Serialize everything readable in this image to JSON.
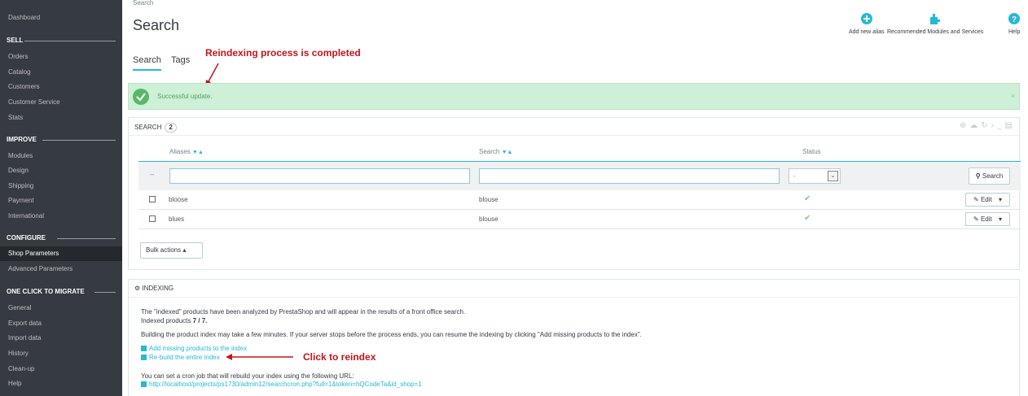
{
  "sidebar": {
    "dashboard": "Dashboard",
    "sections": [
      {
        "title": "SELL",
        "items": [
          "Orders",
          "Catalog",
          "Customers",
          "Customer Service",
          "Stats"
        ]
      },
      {
        "title": "IMPROVE",
        "items": [
          "Modules",
          "Design",
          "Shipping",
          "Payment",
          "International"
        ]
      },
      {
        "title": "CONFIGURE",
        "items": [
          "Shop Parameters",
          "Advanced Parameters"
        ]
      },
      {
        "title": "ONE CLICK TO MIGRATE",
        "items": [
          "General",
          "Export data",
          "Import data",
          "History",
          "Clean-up",
          "Help"
        ]
      }
    ],
    "active_item": "Shop Parameters"
  },
  "header": {
    "breadcrumb": "Search",
    "title": "Search",
    "toolbar": [
      {
        "label": "Add new alias",
        "icon": "plus-circle-icon"
      },
      {
        "label": "Recommended Modules and Services",
        "icon": "puzzle-icon"
      },
      {
        "label": "Help",
        "icon": "question-icon"
      }
    ]
  },
  "tabs": [
    "Search",
    "Tags"
  ],
  "annotations": {
    "reindex_done": "Reindexing process is completed",
    "click_reindex": "Click to reindex"
  },
  "alert": {
    "message": "Successful update.",
    "close": "×"
  },
  "search_panel": {
    "title": "SEARCH",
    "count": "2",
    "columns": [
      "Aliases",
      "Search",
      "Status"
    ],
    "filter_reset": "--",
    "status_select": "-",
    "search_button": "Search",
    "rows": [
      {
        "alias": "bloose",
        "search": "blouse",
        "status": "✔",
        "action": "Edit"
      },
      {
        "alias": "blues",
        "search": "blouse",
        "status": "✔",
        "action": "Edit"
      }
    ],
    "bulk_actions": "Bulk actions ▴",
    "toolbar_icons": [
      "add-icon",
      "upload-icon",
      "refresh-icon",
      "terminal-icon",
      "database-icon"
    ]
  },
  "indexing_panel": {
    "title": "INDEXING",
    "line1": "The \"indexed\" products have been analyzed by PrestaShop and will appear in the results of a front office search.",
    "indexed_label": "Indexed products",
    "indexed_value": "7 / 7.",
    "line2": "Building the product index may take a few minutes. If your server stops before the process ends, you can resume the indexing by clicking \"Add missing products to the index\".",
    "link_missing": "Add missing products to the index",
    "link_rebuild": "Re-build the entire index",
    "cron_text": "You can set a cron job that will rebuild your index using the following URL:",
    "cron_url": "http://localhost/projects/ps1730/admin12/searchcron.php?full=1&token=hQCodeTa&id_shop=1"
  },
  "colors": {
    "sidebar_bg": "#363a41",
    "accent": "#25b9d7",
    "success": "#59b768",
    "annotation": "#c1151a"
  }
}
